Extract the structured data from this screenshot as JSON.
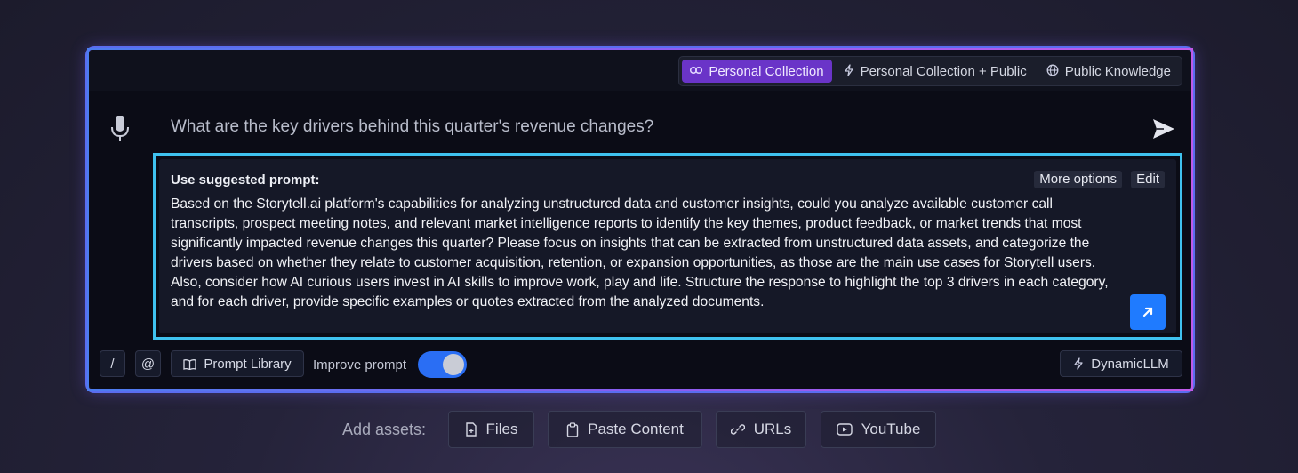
{
  "scope_tabs": [
    {
      "label": "Personal Collection",
      "icon": "collection-icon",
      "active": true
    },
    {
      "label": "Personal Collection + Public",
      "icon": "lightning-icon",
      "active": false
    },
    {
      "label": "Public Knowledge",
      "icon": "globe-icon",
      "active": false
    }
  ],
  "input": {
    "question": "What are the key drivers behind this quarter's revenue changes?"
  },
  "suggestion": {
    "title": "Use suggested prompt:",
    "more_options": "More options",
    "edit": "Edit",
    "text": "Based on the Storytell.ai platform's capabilities for analyzing unstructured data and customer insights, could you analyze available customer call transcripts, prospect meeting notes, and relevant market intelligence reports to identify the key themes, product feedback, or market trends that most significantly impacted revenue changes this quarter? Please focus on insights that can be extracted from unstructured data assets, and categorize the drivers based on whether they relate to customer acquisition, retention, or expansion opportunities, as those are the main use cases for Storytell users. Also, consider how AI curious users invest in AI skills to improve work, play and life. Structure the response to highlight the top 3 drivers in each category, and for each driver, provide specific examples or quotes extracted from the analyzed documents."
  },
  "toolbar": {
    "slash": "/",
    "mention": "@",
    "prompt_library": "Prompt Library",
    "improve_prompt": "Improve prompt",
    "improve_enabled": true,
    "model": "DynamicLLM"
  },
  "assets": {
    "label": "Add assets:",
    "items": [
      {
        "label": "Files",
        "icon": "file-icon"
      },
      {
        "label": "Paste Content",
        "icon": "clipboard-icon"
      },
      {
        "label": "URLs",
        "icon": "link-icon"
      },
      {
        "label": "YouTube",
        "icon": "youtube-icon"
      }
    ]
  },
  "colors": {
    "accent_purple": "#6a34c8",
    "highlight_cyan": "#3fc2ef",
    "button_blue": "#1f7bff"
  }
}
